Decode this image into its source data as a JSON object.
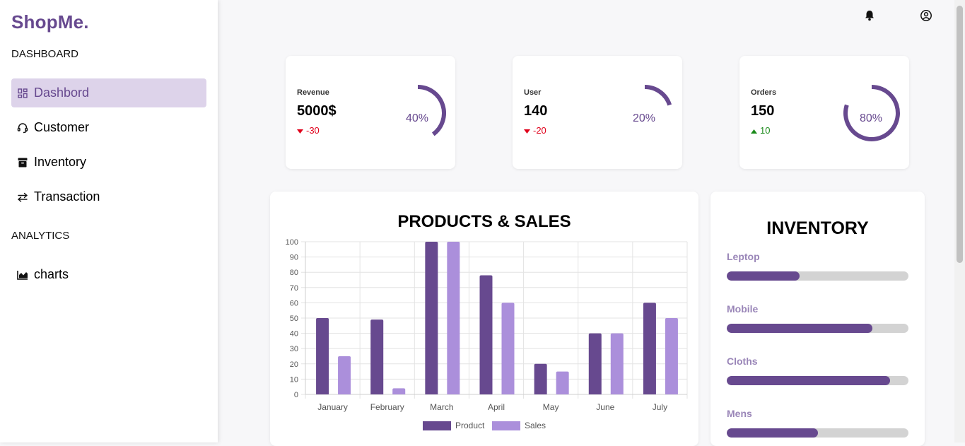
{
  "sidebar": {
    "brand": "ShopMe.",
    "dashboard_heading": "DASHBOARD",
    "analytics_heading": "ANALYTICS",
    "items": [
      {
        "label": "Dashbord",
        "icon": "grid-icon",
        "active": true
      },
      {
        "label": "Customer",
        "icon": "headset-icon",
        "active": false
      },
      {
        "label": "Inventory",
        "icon": "archive-icon",
        "active": false
      },
      {
        "label": "Transaction",
        "icon": "transfer-icon",
        "active": false
      }
    ],
    "analytics_items": [
      {
        "label": "charts",
        "icon": "area-chart-icon"
      }
    ]
  },
  "topbar": {
    "icons": [
      "bell-icon",
      "user-circle-icon"
    ]
  },
  "colors": {
    "accent": "#67498f",
    "accent_light": "#ab8fdb",
    "active_bg": "#ddd3ea",
    "down": "#e0001a",
    "up": "#1a8a1a"
  },
  "cards": [
    {
      "label": "Revenue",
      "value": "5000$",
      "delta": "-30",
      "direction": "down",
      "percent": "40%",
      "fraction": 0.4
    },
    {
      "label": "User",
      "value": "140",
      "delta": "-20",
      "direction": "down",
      "percent": "20%",
      "fraction": 0.2
    },
    {
      "label": "Orders",
      "value": "150",
      "delta": "10",
      "direction": "up",
      "percent": "80%",
      "fraction": 0.8
    }
  ],
  "chart_data": {
    "type": "bar",
    "title": "PRODUCTS & SALES",
    "categories": [
      "January",
      "February",
      "March",
      "April",
      "May",
      "June",
      "July"
    ],
    "series": [
      {
        "name": "Product",
        "values": [
          50,
          49,
          100,
          78,
          20,
          40,
          60
        ],
        "color": "#67498f"
      },
      {
        "name": "Sales",
        "values": [
          25,
          4,
          100,
          60,
          15,
          40,
          50
        ],
        "color": "#ab8fdb"
      }
    ],
    "ylim": [
      0,
      100
    ],
    "yticks": [
      "0",
      "10",
      "20",
      "30",
      "40",
      "50",
      "60",
      "70",
      "80",
      "90",
      "100"
    ],
    "grid": true,
    "legend": "bottom"
  },
  "inventory": {
    "title": "INVENTORY",
    "items": [
      {
        "label": "Leptop",
        "fraction": 0.4
      },
      {
        "label": "Mobile",
        "fraction": 0.8
      },
      {
        "label": "Cloths",
        "fraction": 0.9
      },
      {
        "label": "Mens",
        "fraction": 0.5
      }
    ]
  }
}
